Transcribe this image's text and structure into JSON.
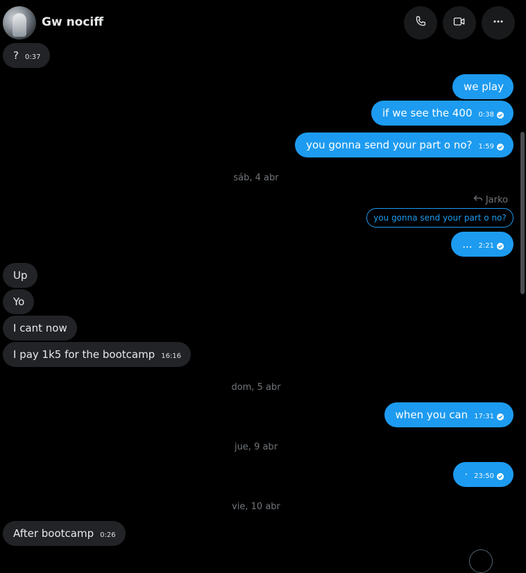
{
  "header": {
    "contact_name": "Gw nociff"
  },
  "icons": {
    "call": "phone-icon",
    "video": "video-camera-icon",
    "more": "more-horizontal-icon",
    "reply": "reply-arrow-icon",
    "read": "check-circle-icon"
  },
  "colors": {
    "background": "#000000",
    "incoming_bubble": "#212327",
    "outgoing_bubble": "#1d9bf0",
    "muted_text": "#71767b"
  },
  "messages": [
    {
      "id": "m1",
      "direction": "in",
      "text": "?",
      "time": "0:37"
    },
    {
      "id": "m2",
      "direction": "out",
      "text": "we play",
      "time": ""
    },
    {
      "id": "m3",
      "direction": "out",
      "text": "if we see the 400",
      "time": "0:38"
    },
    {
      "id": "m4",
      "direction": "out",
      "text": "you gonna send your part o no?",
      "time": "1:59"
    },
    {
      "id": "m5",
      "direction": "out",
      "text": "...",
      "time": "2:21"
    },
    {
      "id": "m6",
      "direction": "in",
      "text": "Up",
      "time": ""
    },
    {
      "id": "m7",
      "direction": "in",
      "text": "Yo",
      "time": ""
    },
    {
      "id": "m8",
      "direction": "in",
      "text": "I cant now",
      "time": ""
    },
    {
      "id": "m9",
      "direction": "in",
      "text": "I pay 1k5 for the bootcamp",
      "time": "16:16"
    },
    {
      "id": "m10",
      "direction": "out",
      "text": "when you can",
      "time": "17:31"
    },
    {
      "id": "m11",
      "direction": "out",
      "text": "·",
      "time": "23:50"
    },
    {
      "id": "m12",
      "direction": "in",
      "text": "After bootcamp",
      "time": "0:26"
    }
  ],
  "dates": [
    "sáb, 4 abr",
    "dom, 5 abr",
    "jue, 9 abr",
    "vie, 10 abr"
  ],
  "reply": {
    "author": "Jarko",
    "quoted_text": "you gonna send your part o no?"
  }
}
